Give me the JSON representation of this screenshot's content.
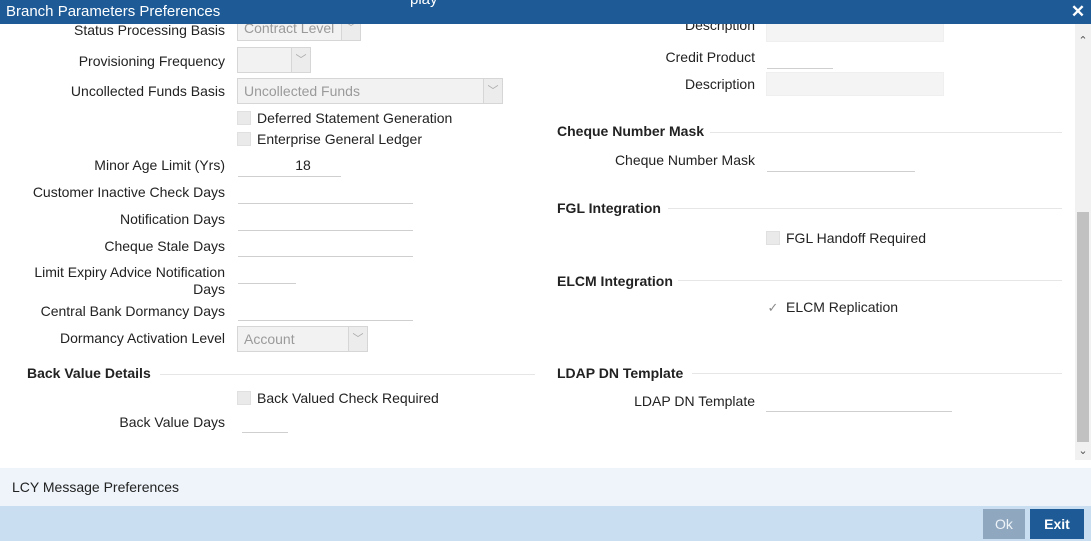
{
  "window": {
    "title": "Branch Parameters Preferences",
    "title_clipped": "play",
    "close_glyph": "✕"
  },
  "left": {
    "status_processing_basis": {
      "label": "Status Processing Basis",
      "value": "Contract Level"
    },
    "provisioning_frequency": {
      "label": "Provisioning Frequency",
      "value": ""
    },
    "uncollected_funds_basis": {
      "label": "Uncollected Funds Basis",
      "value": "Uncollected Funds"
    },
    "deferred_statement_generation": {
      "label": "Deferred Statement Generation",
      "checked": false
    },
    "enterprise_general_ledger": {
      "label": "Enterprise General Ledger",
      "checked": false
    },
    "minor_age_limit": {
      "label": "Minor Age Limit (Yrs)",
      "value": "18"
    },
    "customer_inactive_check_days": {
      "label": "Customer Inactive Check Days",
      "value": ""
    },
    "notification_days": {
      "label": "Notification Days",
      "value": ""
    },
    "cheque_stale_days": {
      "label": "Cheque Stale Days",
      "value": ""
    },
    "limit_expiry_advice_notification_days": {
      "label": "Limit Expiry Advice Notification Days",
      "value": ""
    },
    "central_bank_dormancy_days": {
      "label": "Central Bank Dormancy Days",
      "value": ""
    },
    "dormancy_activation_level": {
      "label": "Dormancy Activation Level",
      "value": "Account"
    },
    "back_value_details": {
      "title": "Back Value Details",
      "back_valued_check_required": {
        "label": "Back Valued Check Required",
        "checked": false
      },
      "back_value_days": {
        "label": "Back Value Days",
        "value": ""
      }
    }
  },
  "right": {
    "description_top": {
      "label": "Description",
      "value": ""
    },
    "credit_product": {
      "label": "Credit Product",
      "value": ""
    },
    "description": {
      "label": "Description",
      "value": ""
    },
    "cheque_number_mask_section": {
      "title": "Cheque Number Mask",
      "cheque_number_mask": {
        "label": "Cheque Number Mask",
        "value": ""
      }
    },
    "fgl_integration": {
      "title": "FGL Integration",
      "fgl_handoff_required": {
        "label": "FGL Handoff Required",
        "checked": false
      }
    },
    "elcm_integration": {
      "title": "ELCM Integration",
      "elcm_replication": {
        "label": "ELCM Replication",
        "checked": true
      }
    },
    "ldap_dn_template_section": {
      "title": "LDAP DN Template",
      "ldap_dn_template": {
        "label": "LDAP DN Template",
        "value": ""
      }
    }
  },
  "icons": {
    "dropdown": "﹀",
    "check": "✓",
    "scroll_up": "⌃",
    "scroll_down": "⌄"
  },
  "lcy_bar": {
    "label": "LCY Message Preferences"
  },
  "footer": {
    "ok_label": "Ok",
    "exit_label": "Exit"
  },
  "colors": {
    "titlebar": "#1d5a96",
    "footer": "#c9def0",
    "lcy_bar": "#eef4fa",
    "exit_button": "#1d5a96",
    "ok_button_disabled": "#8fa8c0"
  }
}
